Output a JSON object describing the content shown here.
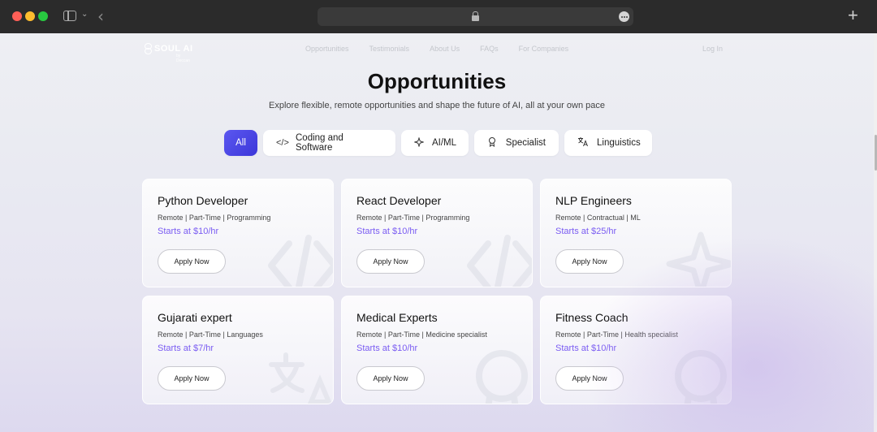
{
  "nav": {
    "logo": "SOUL AI",
    "logo_sub": "by Deccan",
    "links": [
      "Opportunities",
      "Testimonials",
      "About Us",
      "FAQs",
      "For Companies"
    ],
    "login": "Log In"
  },
  "hero": {
    "title": "Opportunities",
    "subtitle": "Explore flexible, remote opportunities and shape the future of AI, all at your own pace"
  },
  "filters": [
    {
      "label": "All",
      "icon": "none",
      "active": true
    },
    {
      "label": "Coding and Software",
      "icon": "code-icon"
    },
    {
      "label": "AI/ML",
      "icon": "sparkle-icon"
    },
    {
      "label": "Specialist",
      "icon": "badge-icon"
    },
    {
      "label": "Linguistics",
      "icon": "translate-icon"
    }
  ],
  "cards": [
    {
      "title": "Python Developer",
      "tags": "Remote | Part-Time | Programming",
      "price": "Starts at $10/hr",
      "button": "Apply Now",
      "watermark": "code-icon"
    },
    {
      "title": "React Developer",
      "tags": "Remote | Part-Time | Programming",
      "price": "Starts at $10/hr",
      "button": "Apply Now",
      "watermark": "code-icon"
    },
    {
      "title": "NLP Engineers",
      "tags": "Remote | Contractual | ML",
      "price": "Starts at $25/hr",
      "button": "Apply Now",
      "watermark": "sparkle-icon"
    },
    {
      "title": "Gujarati expert",
      "tags": "Remote | Part-Time | Languages",
      "price": "Starts at $7/hr",
      "button": "Apply Now",
      "watermark": "translate-icon"
    },
    {
      "title": "Medical Experts",
      "tags": "Remote | Part-Time | Medicine specialist",
      "price": "Starts at $10/hr",
      "button": "Apply Now",
      "watermark": "badge-icon"
    },
    {
      "title": "Fitness Coach",
      "tags": "Remote | Part-Time | Health specialist",
      "price": "Starts at $10/hr",
      "button": "Apply Now",
      "watermark": "badge-icon"
    }
  ],
  "colors": {
    "accent": "#4a46e6",
    "price": "#7a5cf2"
  }
}
